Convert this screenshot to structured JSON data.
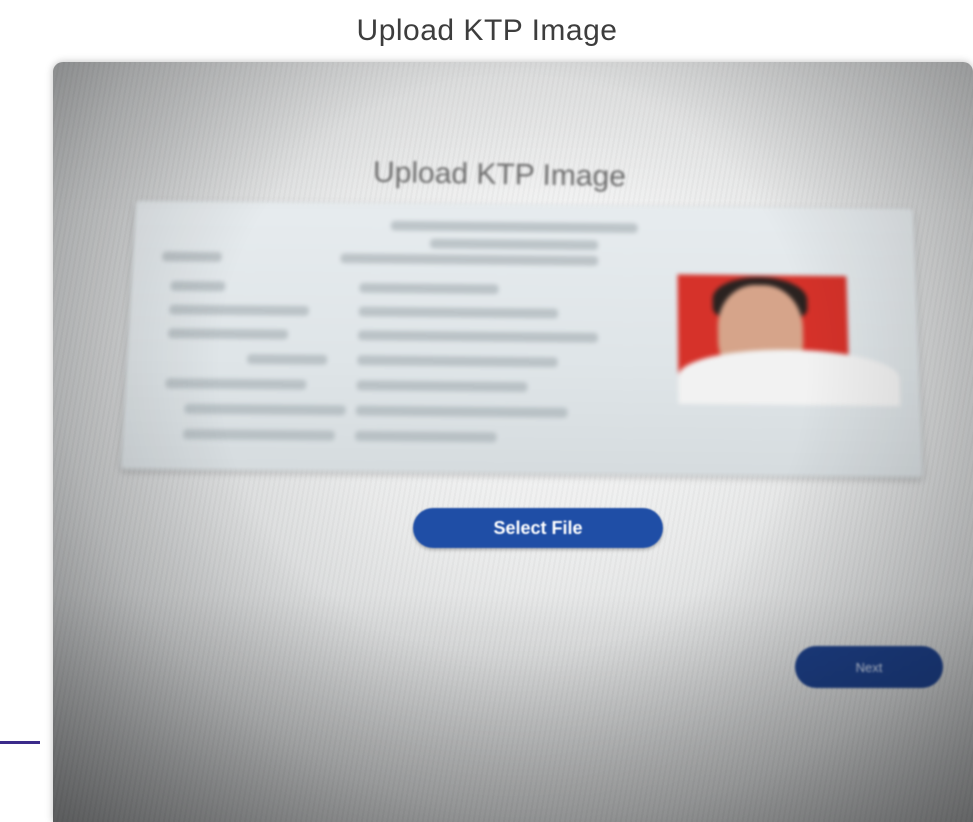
{
  "page": {
    "title": "Upload KTP Image"
  },
  "photo": {
    "inner_title": "Upload KTP Image",
    "select_file_label": "Select File",
    "next_label": "Next"
  },
  "colors": {
    "button_blue": "#1f4ea6",
    "next_blue": "#1d3f86",
    "ktp_photo_bg": "#d6322a",
    "accent_line": "#3b2a8a"
  },
  "icons": {
    "ktp_card": "id-card-image"
  }
}
